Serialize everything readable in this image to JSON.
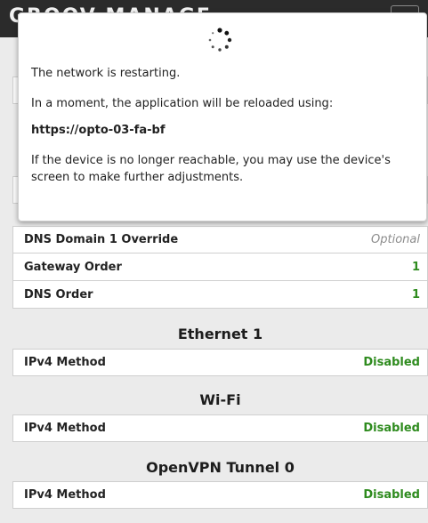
{
  "app": {
    "title": "GROOV MANAGE"
  },
  "modal": {
    "restarting": "The network is restarting.",
    "reload_notice": "In a moment, the application will be reloaded using:",
    "url": "https://opto-03-fa-bf",
    "unreachable_notice": "If the device is no longer reachable, you may use the device's screen to make further adjustments."
  },
  "general_rows": [
    {
      "label": "DNS Domain 1 Override",
      "value": "Optional"
    },
    {
      "label": "Gateway Order",
      "value": "1"
    },
    {
      "label": "DNS Order",
      "value": "1"
    }
  ],
  "ethernet1": {
    "title": "Ethernet 1",
    "label": "IPv4 Method",
    "value": "Disabled"
  },
  "wifi": {
    "title": "Wi-Fi",
    "label": "IPv4 Method",
    "value": "Disabled"
  },
  "openvpn": {
    "title": "OpenVPN Tunnel 0",
    "label": "IPv4 Method",
    "value": "Disabled"
  },
  "colors": {
    "status_green": "#2e8b1e",
    "optional_gray": "#8c8c8c",
    "appbar": "#2b2b2b"
  }
}
